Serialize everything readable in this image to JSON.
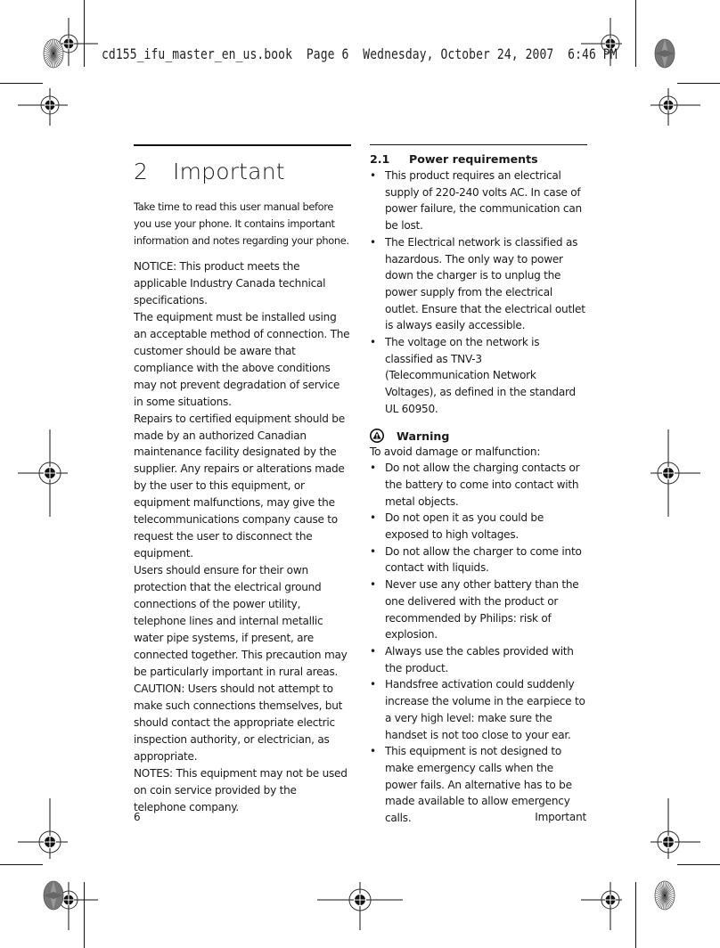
{
  "print_slug": "cd155_ifu_master_en_us.book  Page 6  Wednesday, October 24, 2007  6:46 PM",
  "chapter": {
    "number": "2",
    "title": "Important",
    "intro": "Take time to read this user manual before you use your phone. It contains important information and notes regarding your phone."
  },
  "left_column": {
    "paragraphs": [
      "NOTICE: This product meets the applicable Industry Canada technical specifications.",
      "The equipment must be installed using an acceptable method of connection. The customer should be aware that compliance with the above conditions may not prevent degradation of service in some situations.",
      "Repairs to certified equipment should be made by an authorized Canadian maintenance facility designated by the supplier. Any repairs or alterations made by the user to this equipment, or equipment malfunctions, may give the telecommunications company cause to request the user to disconnect the equipment.",
      "Users should ensure for their own protection that the electrical ground connections of the power utility, telephone lines and internal metallic water pipe systems, if present, are connected together. This precaution may be particularly important in rural areas.",
      "CAUTION: Users should not attempt to make such connections themselves, but should contact the appropriate electric inspection authority, or electrician, as appropriate.",
      "NOTES: This equipment may not be used on coin service provided by the telephone company."
    ]
  },
  "right_column": {
    "section": {
      "number": "2.1",
      "title": "Power requirements"
    },
    "bullets": [
      "This product requires an electrical supply of 220-240 volts AC. In case of power failure, the communication can be lost.",
      "The Electrical network is classified as hazardous. The only way to power down the charger is to unplug the power supply from the electrical outlet. Ensure that the electrical outlet is always easily accessible.",
      "The voltage on the network is classified as TNV-3 (Telecommunication Network Voltages), as defined in the standard UL 60950."
    ],
    "warning": {
      "icon": "warning-triangle-icon",
      "title": "Warning",
      "intro": "To avoid damage or malfunction:",
      "bullets": [
        "Do not allow the charging contacts or the battery to come into contact with metal objects.",
        "Do not open it as you could be exposed to high voltages.",
        "Do not allow the charger to come into contact with liquids.",
        "Never use any other battery than the one delivered with the product or recommended by Philips: risk of explosion.",
        "Always use the cables provided with the product.",
        "Handsfree activation could suddenly increase the volume in the earpiece to a very high level: make sure the handset is not too close to your ear.",
        "This equipment is not designed to make emergency calls when the power fails. An alternative has to be made available to allow emergency calls."
      ]
    }
  },
  "footer": {
    "page_number": "6",
    "running_title": "Important"
  },
  "bullet_glyph": "•"
}
